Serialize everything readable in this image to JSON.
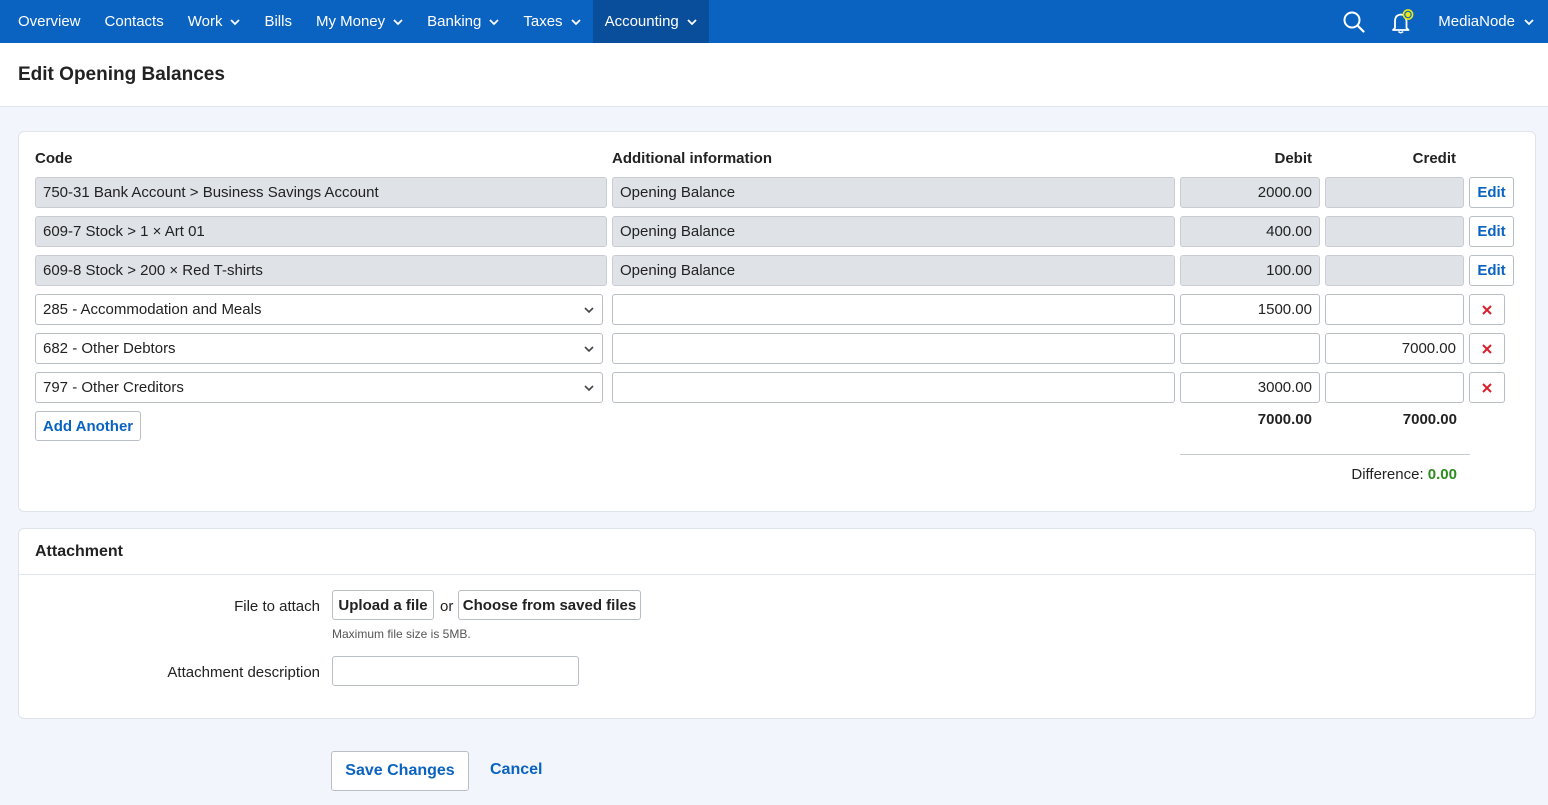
{
  "nav": {
    "items": [
      {
        "label": "Overview",
        "has_menu": false
      },
      {
        "label": "Contacts",
        "has_menu": false
      },
      {
        "label": "Work",
        "has_menu": true
      },
      {
        "label": "Bills",
        "has_menu": false
      },
      {
        "label": "My Money",
        "has_menu": true
      },
      {
        "label": "Banking",
        "has_menu": true
      },
      {
        "label": "Taxes",
        "has_menu": true
      },
      {
        "label": "Accounting",
        "has_menu": true,
        "active": true
      }
    ],
    "user": "MediaNode",
    "icons": [
      "search-icon",
      "bell-icon"
    ]
  },
  "page": {
    "title": "Edit Opening Balances"
  },
  "table": {
    "headers": {
      "code": "Code",
      "info": "Additional information",
      "debit": "Debit",
      "credit": "Credit"
    },
    "readonly_rows": [
      {
        "code": "750-31 Bank Account  >  Business Savings Account",
        "info": "Opening Balance",
        "debit": "2000.00",
        "credit": "",
        "action": "Edit"
      },
      {
        "code": "609-7 Stock  >  1 × Art 01",
        "info": "Opening Balance",
        "debit": "400.00",
        "credit": "",
        "action": "Edit"
      },
      {
        "code": "609-8 Stock  >  200 × Red T-shirts",
        "info": "Opening Balance",
        "debit": "100.00",
        "credit": "",
        "action": "Edit"
      }
    ],
    "editable_rows": [
      {
        "code": "285 - Accommodation and Meals",
        "info": "",
        "debit": "1500.00",
        "credit": ""
      },
      {
        "code": "682 - Other Debtors",
        "info": "",
        "debit": "",
        "credit": "7000.00"
      },
      {
        "code": "797 - Other Creditors",
        "info": "",
        "debit": "3000.00",
        "credit": ""
      }
    ],
    "add_label": "Add Another",
    "total_debit": "7000.00",
    "total_credit": "7000.00",
    "difference_label": "Difference:",
    "difference_value": "0.00"
  },
  "attachment": {
    "title": "Attachment",
    "file_label": "File to attach",
    "upload_label": "Upload a file",
    "or_label": "or",
    "choose_label": "Choose from saved files",
    "hint": "Maximum file size is 5MB.",
    "desc_label": "Attachment description",
    "desc_value": ""
  },
  "actions": {
    "save": "Save Changes",
    "cancel": "Cancel"
  },
  "colors": {
    "nav_bg": "#0b63c1",
    "nav_active": "#084e9a",
    "link": "#0b63c1",
    "success": "#2e8b1e",
    "danger": "#d8202a",
    "bell_dot": "#e8e81a"
  }
}
